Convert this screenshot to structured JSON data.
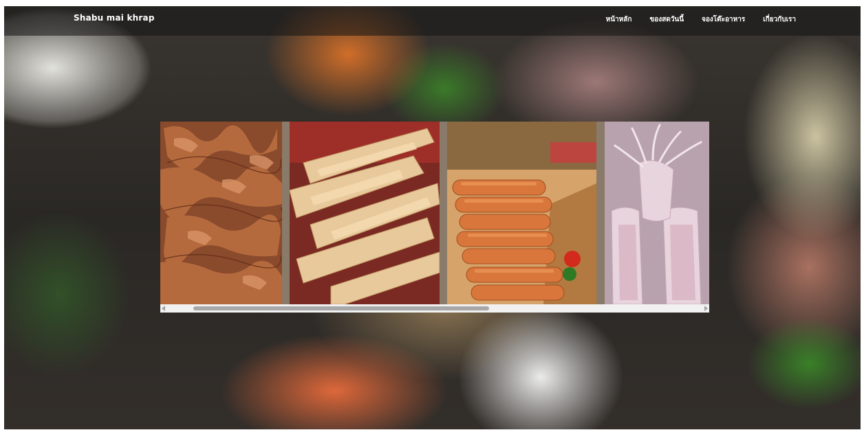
{
  "navbar": {
    "brand": "Shabu mai khrap",
    "links": [
      {
        "label": "หน้าหลัก"
      },
      {
        "label": "ของสดวันนี้"
      },
      {
        "label": "จองโต๊ะอาหาร"
      },
      {
        "label": "เกี่ยวกับเรา"
      }
    ]
  },
  "gallery": {
    "photos": [
      {
        "icon": "sliced-beef-photo"
      },
      {
        "icon": "dried-squid-photo"
      },
      {
        "icon": "sausages-photo"
      },
      {
        "icon": "fresh-squid-photo"
      }
    ],
    "scroll_position": 0.06
  },
  "colors": {
    "navbar_bg": "#141414",
    "nav_text": "#ffffff",
    "scrollbar_track": "#f1f1f1",
    "scrollbar_thumb": "#a8a8a8"
  }
}
